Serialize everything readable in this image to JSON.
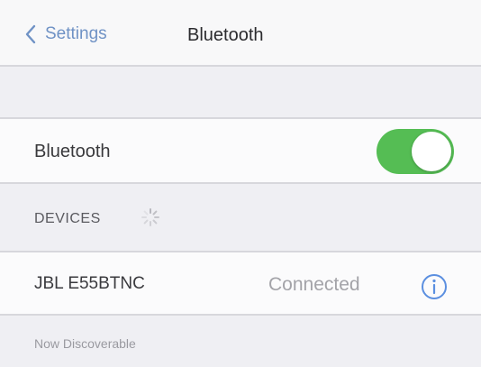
{
  "navbar": {
    "back_label": "Settings",
    "title": "Bluetooth"
  },
  "bluetooth_row": {
    "label": "Bluetooth",
    "toggle_on": true
  },
  "devices_section": {
    "header": "DEVICES",
    "icon": "spinner-icon"
  },
  "devices": [
    {
      "name": "JBL E55BTNC",
      "status": "Connected",
      "icon": "info-icon"
    }
  ],
  "footer": {
    "text": "Now Discoverable"
  },
  "colors": {
    "accent": "#6f92c5",
    "toggle_on": "#55bd54",
    "info": "#5b8fe0"
  }
}
